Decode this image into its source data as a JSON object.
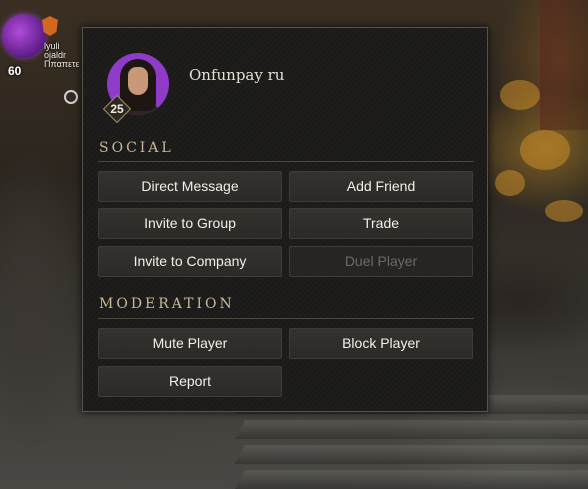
{
  "hud": {
    "level": "60",
    "name_lines": [
      "lyuli",
      "ojaldr",
      "Ππαπετε"
    ]
  },
  "menu": {
    "player_name": "Onfunpay ru",
    "player_level": "25",
    "sections": {
      "social": {
        "title": "SOCIAL",
        "buttons": {
          "direct_message": {
            "label": "Direct Message",
            "enabled": true
          },
          "add_friend": {
            "label": "Add Friend",
            "enabled": true
          },
          "invite_group": {
            "label": "Invite to Group",
            "enabled": true
          },
          "trade": {
            "label": "Trade",
            "enabled": true
          },
          "invite_company": {
            "label": "Invite to Company",
            "enabled": true
          },
          "duel_player": {
            "label": "Duel Player",
            "enabled": false
          }
        }
      },
      "moderation": {
        "title": "MODERATION",
        "buttons": {
          "mute_player": {
            "label": "Mute Player",
            "enabled": true
          },
          "block_player": {
            "label": "Block Player",
            "enabled": true
          },
          "report": {
            "label": "Report",
            "enabled": true
          }
        }
      }
    }
  },
  "colors": {
    "panel_bg": "#1b1a18",
    "button_bg": "#2f2d2a",
    "section_title": "#c9b996",
    "disabled_text": "#6d6a64",
    "avatar_bg": "#8e3cc8"
  }
}
